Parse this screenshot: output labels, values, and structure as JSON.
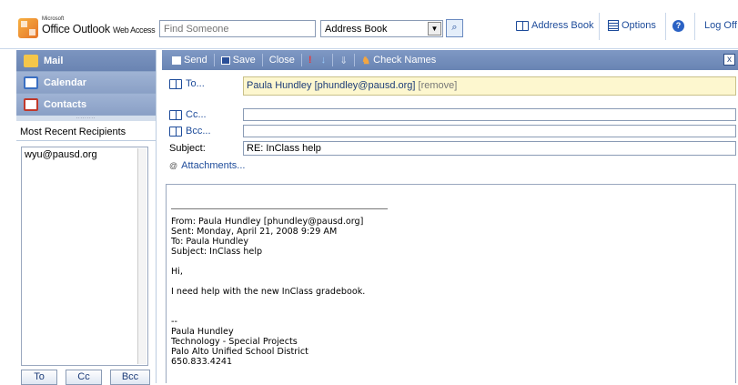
{
  "header": {
    "logo_microsoft": "Microsoft",
    "logo_name": "Office Outlook",
    "logo_suffix": "Web Access",
    "find_placeholder": "Find Someone",
    "address_select": "Address Book",
    "links": {
      "address_book": "Address Book",
      "options": "Options",
      "log_off": "Log Off"
    }
  },
  "sidebar": {
    "nav": [
      {
        "label": "Mail"
      },
      {
        "label": "Calendar"
      },
      {
        "label": "Contacts"
      }
    ],
    "recent_title": "Most Recent Recipients",
    "recent": [
      "wyu@pausd.org"
    ],
    "buttons": {
      "to": "To",
      "cc": "Cc",
      "bcc": "Bcc"
    }
  },
  "toolbar": {
    "send": "Send",
    "save": "Save",
    "close": "Close",
    "check_names": "Check Names",
    "close_x": "x"
  },
  "compose": {
    "to_label": "To...",
    "to_value": "Paula Hundley [phundley@pausd.org]",
    "to_remove": "[remove]",
    "cc_label": "Cc...",
    "bcc_label": "Bcc...",
    "subject_label": "Subject:",
    "subject_value": "RE: InClass help",
    "attachments_label": "Attachments..."
  },
  "message": {
    "lines": [
      "From: Paula Hundley [phundley@pausd.org]",
      "Sent: Monday, April 21, 2008 9:29 AM",
      "To: Paula Hundley",
      "Subject: InClass help",
      "",
      "Hi,",
      "",
      "I need help with the new InClass gradebook.",
      "",
      "",
      "--",
      "Paula Hundley",
      "Technology - Special Projects",
      "Palo Alto Unified School District",
      "650.833.4241"
    ]
  },
  "colors": {
    "toolbar": "#6f89b8",
    "link": "#1d4b9a",
    "to_highlight": "#fdf7cf"
  }
}
